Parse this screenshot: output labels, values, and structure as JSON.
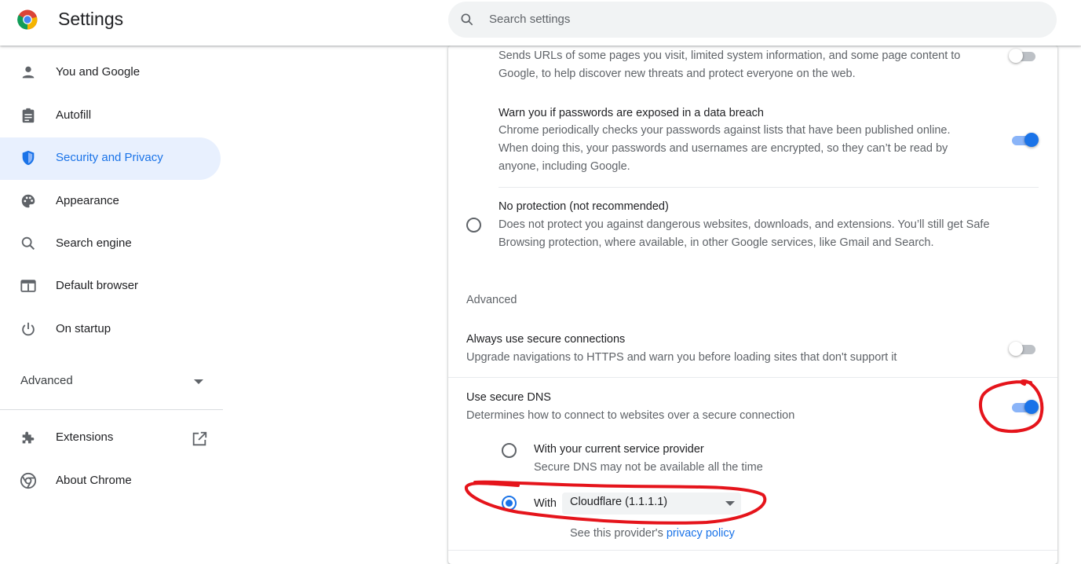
{
  "header": {
    "title": "Settings",
    "search_placeholder": "Search settings",
    "logo": "chrome-logo-icon",
    "search_icon": "search-icon"
  },
  "sidebar": {
    "items": [
      {
        "label": "You and Google",
        "icon": "person-icon"
      },
      {
        "label": "Autofill",
        "icon": "clipboard-icon"
      },
      {
        "label": "Security and Privacy",
        "icon": "shield-icon",
        "active": true
      },
      {
        "label": "Appearance",
        "icon": "palette-icon"
      },
      {
        "label": "Search engine",
        "icon": "search-icon"
      },
      {
        "label": "Default browser",
        "icon": "browser-window-icon"
      },
      {
        "label": "On startup",
        "icon": "power-icon"
      }
    ],
    "advanced_label": "Advanced",
    "extensions_label": "Extensions",
    "about_label": "About Chrome"
  },
  "content": {
    "enhanced_desc": "Sends URLs of some pages you visit, limited system information, and some page content to Google, to help discover new threats and protect everyone on the web.",
    "pwd_title": "Warn you if passwords are exposed in a data breach",
    "pwd_desc": "Chrome periodically checks your passwords against lists that have been published online. When doing this, your passwords and usernames are encrypted, so they can’t be read by anyone, including Google.",
    "noprot_title": "No protection (not recommended)",
    "noprot_desc": "Does not protect you against dangerous websites, downloads, and extensions. You’ll still get Safe Browsing protection, where available, in other Google services, like Gmail and Search.",
    "advanced_heading": "Advanced",
    "https_title": "Always use secure connections",
    "https_desc": "Upgrade navigations to HTTPS and warn you before loading sites that don't support it",
    "dns_title": "Use secure DNS",
    "dns_desc": "Determines how to connect to websites over a secure connection",
    "dns_current_title": "With your current service provider",
    "dns_current_desc": "Secure DNS may not be available all the time",
    "dns_with_label": "With",
    "dns_provider_value": "Cloudflare (1.1.1.1)",
    "provider_note": "See this provider's",
    "privacy_policy_link": "privacy policy"
  },
  "toggles": {
    "enhanced": false,
    "password_leak": true,
    "https_only": false,
    "secure_dns": true
  },
  "colors": {
    "accent": "#1a73e8",
    "annotation": "#e5141b"
  }
}
